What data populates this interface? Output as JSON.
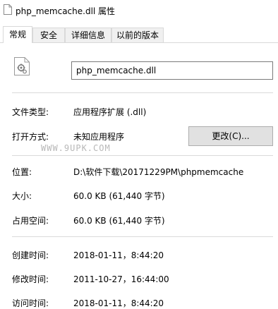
{
  "window": {
    "title": "php_memcache.dll 属性"
  },
  "tabs": [
    {
      "label": "常规",
      "active": true
    },
    {
      "label": "安全",
      "active": false
    },
    {
      "label": "详细信息",
      "active": false
    },
    {
      "label": "以前的版本",
      "active": false
    }
  ],
  "file": {
    "name": "php_memcache.dll",
    "icon": "settings-file-icon"
  },
  "type": {
    "label": "文件类型:",
    "value": "应用程序扩展 (.dll)"
  },
  "opens_with": {
    "label": "打开方式:",
    "value": "未知应用程序",
    "button": "更改(C)..."
  },
  "watermark": "WWW.9UPK.COM",
  "location": {
    "label": "位置:",
    "value": "D:\\软件下载\\20171229PM\\phpmemcache"
  },
  "size": {
    "label": "大小:",
    "value": "60.0 KB (61,440 字节)"
  },
  "size_on_disk": {
    "label": "占用空间:",
    "value": "60.0 KB (61,440 字节)"
  },
  "created": {
    "label": "创建时间:",
    "value": "2018-01-11，8:44:20"
  },
  "modified": {
    "label": "修改时间:",
    "value": "2011-10-27，16:44:00"
  },
  "accessed": {
    "label": "访问时间:",
    "value": "2018-01-11，8:44:20"
  }
}
